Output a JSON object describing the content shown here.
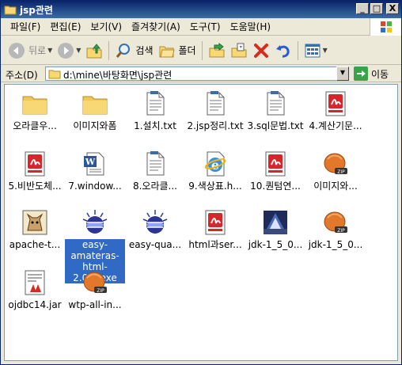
{
  "window": {
    "title": "jsp관련",
    "minimize": "_",
    "maximize": "□",
    "close": "X"
  },
  "menu": [
    "파일(F)",
    "편집(E)",
    "보기(V)",
    "즐겨찾기(A)",
    "도구(T)",
    "도움말(H)"
  ],
  "toolbar": {
    "back": "뒤로",
    "search": "검색",
    "folders": "폴더"
  },
  "address": {
    "label": "주소(D)",
    "path": "d:\\mine\\바탕화면\\jsp관련",
    "go": "이동"
  },
  "files": [
    {
      "name": "오라클우...",
      "icon": "folder-icon"
    },
    {
      "name": "이미지와폼",
      "icon": "folder-icon"
    },
    {
      "name": "1.설치.txt",
      "icon": "text-file-icon"
    },
    {
      "name": "2.jsp정리.txt",
      "icon": "text-file-icon"
    },
    {
      "name": "3.sql문법.txt",
      "icon": "text-file-icon"
    },
    {
      "name": "4.계산기문...",
      "icon": "acrobat-pdf-icon"
    },
    {
      "name": "5.비반도체...",
      "icon": "acrobat-pdf-icon"
    },
    {
      "name": "7.window...",
      "icon": "word-doc-icon"
    },
    {
      "name": "8.오라클...",
      "icon": "text-file-icon"
    },
    {
      "name": "9.색상표.h...",
      "icon": "ie-html-icon"
    },
    {
      "name": "10.퀀텀연...",
      "icon": "acrobat-pdf-icon"
    },
    {
      "name": "이미지와...",
      "icon": "zip-icon"
    },
    {
      "name": "apache-t...",
      "icon": "tomcat-icon"
    },
    {
      "name": "easy-amateras-html-2.0.4.exe",
      "icon": "eclipse-icon",
      "selected": true
    },
    {
      "name": "easy-qua...",
      "icon": "eclipse-icon"
    },
    {
      "name": "html과ser...",
      "icon": "acrobat-pdf-icon"
    },
    {
      "name": "jdk-1_5_0...",
      "icon": "java-installer-icon"
    },
    {
      "name": "jdk-1_5_0...",
      "icon": "zip-icon"
    },
    {
      "name": "ojdbc14.jar",
      "icon": "jar-file-icon"
    },
    {
      "name": "wtp-all-in...",
      "icon": "zip-icon"
    }
  ],
  "colors": {
    "titlebar": "#0a246a",
    "selection": "#316ac5",
    "chrome": "#ece9d8"
  }
}
